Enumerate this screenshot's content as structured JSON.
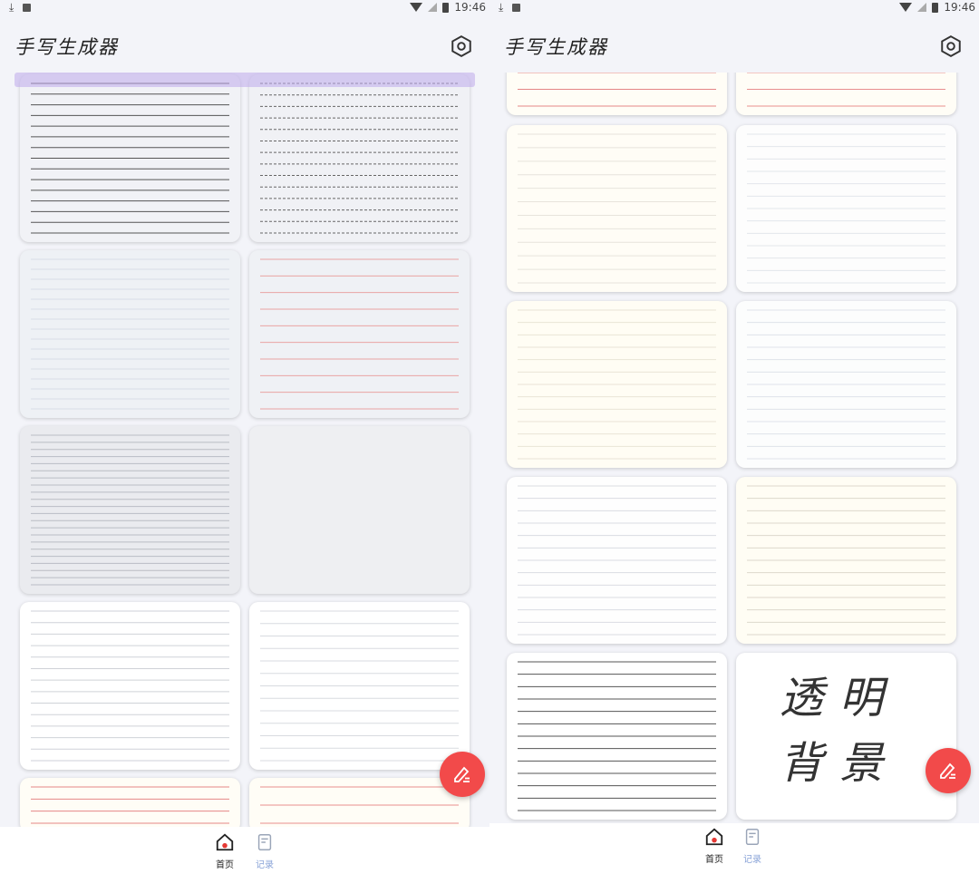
{
  "status": {
    "time": "19:46"
  },
  "app": {
    "title": "手写生成器"
  },
  "nav": {
    "home_label": "首页",
    "records_label": "记录"
  },
  "left_papers": [
    {
      "name": "paper-1",
      "bg": "#f1f2f6",
      "line": "#555",
      "dash": false,
      "lines": 15
    },
    {
      "name": "paper-2",
      "bg": "#f0f1f5",
      "line": "#666",
      "dash": true,
      "lines": 14
    },
    {
      "name": "paper-3",
      "bg": "#eef1f5",
      "line": "#d8dde6",
      "dash": false,
      "lines": 16
    },
    {
      "name": "paper-4",
      "bg": "#eff1f5",
      "line": "#e9a4a4",
      "dash": false,
      "lines": 10
    },
    {
      "name": "paper-5",
      "bg": "#eaebef",
      "line": "#b9bcc4",
      "dash": false,
      "lines": 22
    },
    {
      "name": "paper-6",
      "bg": "#eeeff2",
      "line": "#eeeff2",
      "dash": false,
      "lines": 0
    },
    {
      "name": "paper-7",
      "bg": "#ffffff",
      "line": "#cfd2d8",
      "dash": false,
      "lines": 14
    },
    {
      "name": "paper-8",
      "bg": "#ffffff",
      "line": "#d8dbe0",
      "dash": false,
      "lines": 13
    },
    {
      "name": "paper-9",
      "bg": "#fffdf6",
      "line": "#e58686",
      "dash": false,
      "lines": 4
    },
    {
      "name": "paper-10",
      "bg": "#fffdf6",
      "line": "#e88e8e",
      "dash": false,
      "lines": 3
    }
  ],
  "right_papers": [
    {
      "name": "paper-9",
      "bg": "#fffdf6",
      "line": "#e58686",
      "dash": false,
      "lines": 3
    },
    {
      "name": "paper-10",
      "bg": "#fffdf6",
      "line": "#e88e8e",
      "dash": false,
      "lines": 3
    },
    {
      "name": "paper-11",
      "bg": "#fffdf6",
      "line": "#e7e4dc",
      "dash": false,
      "lines": 12
    },
    {
      "name": "paper-12",
      "bg": "#fdfdfd",
      "line": "#e3e6ec",
      "dash": false,
      "lines": 13
    },
    {
      "name": "paper-13",
      "bg": "#fffdf4",
      "line": "#e9e4d6",
      "dash": false,
      "lines": 13
    },
    {
      "name": "paper-14",
      "bg": "#fcfdfd",
      "line": "#dfe3ea",
      "dash": false,
      "lines": 13
    },
    {
      "name": "paper-15",
      "bg": "#fefefe",
      "line": "#d9dce2",
      "dash": false,
      "lines": 13
    },
    {
      "name": "paper-16",
      "bg": "#fffdf4",
      "line": "#ddd8cc",
      "dash": false,
      "lines": 13
    },
    {
      "name": "paper-17",
      "bg": "#ffffff",
      "line": "#555",
      "dash": false,
      "lines": 13
    },
    {
      "name": "paper-transparent",
      "bg": "#ffffff",
      "line": "#ffffff",
      "dash": false,
      "lines": 0,
      "text": [
        "透明",
        "背景"
      ]
    }
  ],
  "colors": {
    "fab": "#f24a4a",
    "accent": "#8aa4d8"
  }
}
